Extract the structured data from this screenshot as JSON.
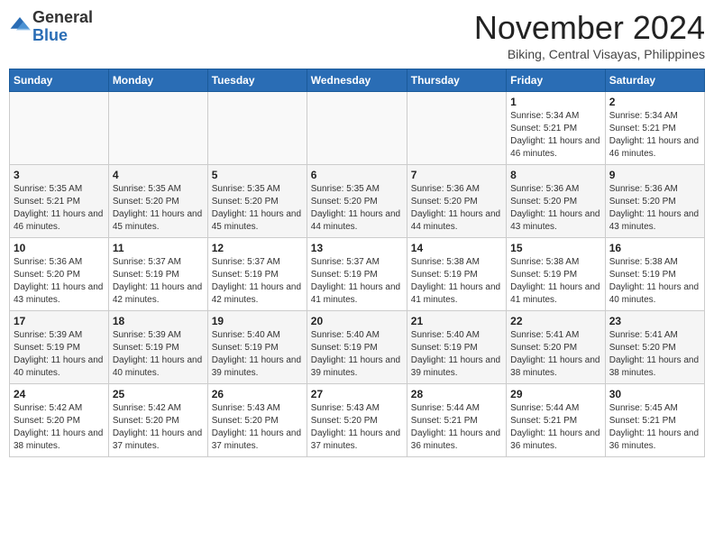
{
  "header": {
    "logo_general": "General",
    "logo_blue": "Blue",
    "month_year": "November 2024",
    "location": "Biking, Central Visayas, Philippines"
  },
  "weekdays": [
    "Sunday",
    "Monday",
    "Tuesday",
    "Wednesday",
    "Thursday",
    "Friday",
    "Saturday"
  ],
  "weeks": [
    [
      {
        "day": "",
        "info": ""
      },
      {
        "day": "",
        "info": ""
      },
      {
        "day": "",
        "info": ""
      },
      {
        "day": "",
        "info": ""
      },
      {
        "day": "",
        "info": ""
      },
      {
        "day": "1",
        "info": "Sunrise: 5:34 AM\nSunset: 5:21 PM\nDaylight: 11 hours and 46 minutes."
      },
      {
        "day": "2",
        "info": "Sunrise: 5:34 AM\nSunset: 5:21 PM\nDaylight: 11 hours and 46 minutes."
      }
    ],
    [
      {
        "day": "3",
        "info": "Sunrise: 5:35 AM\nSunset: 5:21 PM\nDaylight: 11 hours and 46 minutes."
      },
      {
        "day": "4",
        "info": "Sunrise: 5:35 AM\nSunset: 5:20 PM\nDaylight: 11 hours and 45 minutes."
      },
      {
        "day": "5",
        "info": "Sunrise: 5:35 AM\nSunset: 5:20 PM\nDaylight: 11 hours and 45 minutes."
      },
      {
        "day": "6",
        "info": "Sunrise: 5:35 AM\nSunset: 5:20 PM\nDaylight: 11 hours and 44 minutes."
      },
      {
        "day": "7",
        "info": "Sunrise: 5:36 AM\nSunset: 5:20 PM\nDaylight: 11 hours and 44 minutes."
      },
      {
        "day": "8",
        "info": "Sunrise: 5:36 AM\nSunset: 5:20 PM\nDaylight: 11 hours and 43 minutes."
      },
      {
        "day": "9",
        "info": "Sunrise: 5:36 AM\nSunset: 5:20 PM\nDaylight: 11 hours and 43 minutes."
      }
    ],
    [
      {
        "day": "10",
        "info": "Sunrise: 5:36 AM\nSunset: 5:20 PM\nDaylight: 11 hours and 43 minutes."
      },
      {
        "day": "11",
        "info": "Sunrise: 5:37 AM\nSunset: 5:19 PM\nDaylight: 11 hours and 42 minutes."
      },
      {
        "day": "12",
        "info": "Sunrise: 5:37 AM\nSunset: 5:19 PM\nDaylight: 11 hours and 42 minutes."
      },
      {
        "day": "13",
        "info": "Sunrise: 5:37 AM\nSunset: 5:19 PM\nDaylight: 11 hours and 41 minutes."
      },
      {
        "day": "14",
        "info": "Sunrise: 5:38 AM\nSunset: 5:19 PM\nDaylight: 11 hours and 41 minutes."
      },
      {
        "day": "15",
        "info": "Sunrise: 5:38 AM\nSunset: 5:19 PM\nDaylight: 11 hours and 41 minutes."
      },
      {
        "day": "16",
        "info": "Sunrise: 5:38 AM\nSunset: 5:19 PM\nDaylight: 11 hours and 40 minutes."
      }
    ],
    [
      {
        "day": "17",
        "info": "Sunrise: 5:39 AM\nSunset: 5:19 PM\nDaylight: 11 hours and 40 minutes."
      },
      {
        "day": "18",
        "info": "Sunrise: 5:39 AM\nSunset: 5:19 PM\nDaylight: 11 hours and 40 minutes."
      },
      {
        "day": "19",
        "info": "Sunrise: 5:40 AM\nSunset: 5:19 PM\nDaylight: 11 hours and 39 minutes."
      },
      {
        "day": "20",
        "info": "Sunrise: 5:40 AM\nSunset: 5:19 PM\nDaylight: 11 hours and 39 minutes."
      },
      {
        "day": "21",
        "info": "Sunrise: 5:40 AM\nSunset: 5:19 PM\nDaylight: 11 hours and 39 minutes."
      },
      {
        "day": "22",
        "info": "Sunrise: 5:41 AM\nSunset: 5:20 PM\nDaylight: 11 hours and 38 minutes."
      },
      {
        "day": "23",
        "info": "Sunrise: 5:41 AM\nSunset: 5:20 PM\nDaylight: 11 hours and 38 minutes."
      }
    ],
    [
      {
        "day": "24",
        "info": "Sunrise: 5:42 AM\nSunset: 5:20 PM\nDaylight: 11 hours and 38 minutes."
      },
      {
        "day": "25",
        "info": "Sunrise: 5:42 AM\nSunset: 5:20 PM\nDaylight: 11 hours and 37 minutes."
      },
      {
        "day": "26",
        "info": "Sunrise: 5:43 AM\nSunset: 5:20 PM\nDaylight: 11 hours and 37 minutes."
      },
      {
        "day": "27",
        "info": "Sunrise: 5:43 AM\nSunset: 5:20 PM\nDaylight: 11 hours and 37 minutes."
      },
      {
        "day": "28",
        "info": "Sunrise: 5:44 AM\nSunset: 5:21 PM\nDaylight: 11 hours and 36 minutes."
      },
      {
        "day": "29",
        "info": "Sunrise: 5:44 AM\nSunset: 5:21 PM\nDaylight: 11 hours and 36 minutes."
      },
      {
        "day": "30",
        "info": "Sunrise: 5:45 AM\nSunset: 5:21 PM\nDaylight: 11 hours and 36 minutes."
      }
    ]
  ]
}
